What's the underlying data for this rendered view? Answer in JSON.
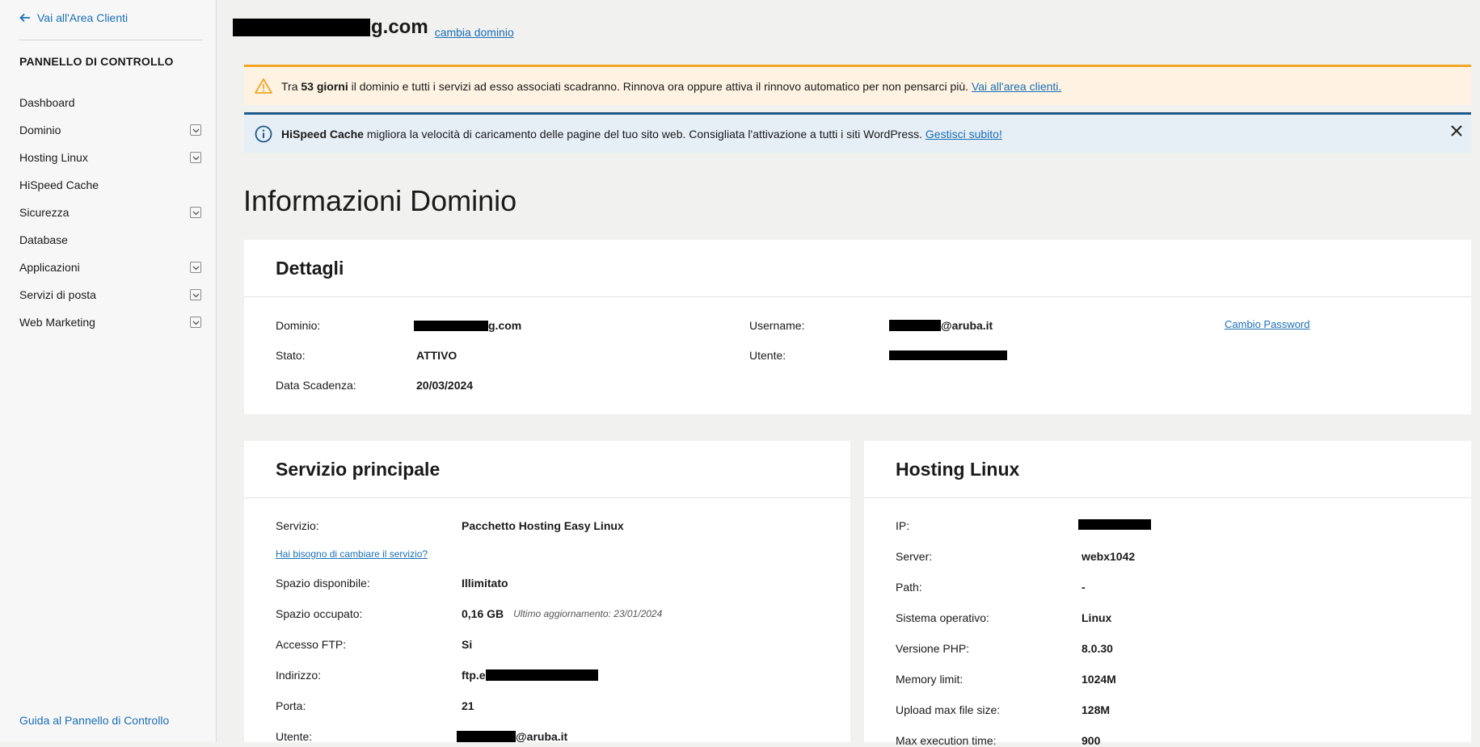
{
  "sidebar": {
    "back_label": "Vai all'Area Clienti",
    "section_title": "PANNELLO DI CONTROLLO",
    "items": [
      {
        "label": "Dashboard",
        "expandable": false
      },
      {
        "label": "Dominio",
        "expandable": true
      },
      {
        "label": "Hosting Linux",
        "expandable": true
      },
      {
        "label": "HiSpeed Cache",
        "expandable": false
      },
      {
        "label": "Sicurezza",
        "expandable": true
      },
      {
        "label": "Database",
        "expandable": false
      },
      {
        "label": "Applicazioni",
        "expandable": true
      },
      {
        "label": "Servizi di posta",
        "expandable": true
      },
      {
        "label": "Web Marketing",
        "expandable": true
      }
    ],
    "guide_label": "Guida al Pannello di Controllo"
  },
  "header": {
    "domain_suffix": "g.com",
    "change_domain_label": "cambia dominio"
  },
  "alerts": {
    "warning": {
      "text_before": "Tra ",
      "days": "53 giorni",
      "text_after": " il dominio e tutti i servizi ad esso associati scadranno. Rinnova ora oppure attiva il rinnovo automatico per non pensarci più. ",
      "link_label": "Vai all'area clienti."
    },
    "info": {
      "bold": "HiSpeed Cache",
      "text": " migliora la velocità di caricamento delle pagine del tuo sito web. Consigliata l'attivazione a tutti i siti WordPress. ",
      "link_label": "Gestisci subito!"
    }
  },
  "page_title": "Informazioni Dominio",
  "details": {
    "title": "Dettagli",
    "domain_label": "Dominio:",
    "domain_value_suffix": "g.com",
    "state_label": "Stato:",
    "state_value": "ATTIVO",
    "expiry_label": "Data Scadenza:",
    "expiry_value": "20/03/2024",
    "username_label": "Username:",
    "username_value_suffix": "@aruba.it",
    "user_label": "Utente:",
    "change_password_label": "Cambio Password"
  },
  "service": {
    "title": "Servizio principale",
    "service_label": "Servizio:",
    "service_value": "Pacchetto Hosting Easy Linux",
    "change_service_link": "Hai bisogno di cambiare il servizio?",
    "space_available_label": "Spazio disponibile:",
    "space_available_value": "Illimitato",
    "space_used_label": "Spazio occupato:",
    "space_used_value": "0,16 GB",
    "space_used_note": "Ultimo aggiornamento: 23/01/2024",
    "ftp_label": "Accesso FTP:",
    "ftp_value": "Si",
    "address_label": "Indirizzo:",
    "address_prefix": "ftp.e",
    "port_label": "Porta:",
    "port_value": "21",
    "user_label": "Utente:",
    "user_suffix": "@aruba.it"
  },
  "hosting": {
    "title": "Hosting Linux",
    "ip_label": "IP:",
    "server_label": "Server:",
    "server_value": "webx1042",
    "path_label": "Path:",
    "path_value": "-",
    "os_label": "Sistema operativo:",
    "os_value": "Linux",
    "php_label": "Versione PHP:",
    "php_value": "8.0.30",
    "memory_label": "Memory limit:",
    "memory_value": "1024M",
    "upload_label": "Upload max file size:",
    "upload_value": "128M",
    "exec_label": "Max execution time:",
    "exec_value": "900"
  },
  "colors": {
    "link": "#1a6fb5",
    "warning_border": "#f0a623",
    "warning_bg": "#fef3e3",
    "info_border": "#1f5a8a",
    "info_bg": "#e6eef6"
  }
}
